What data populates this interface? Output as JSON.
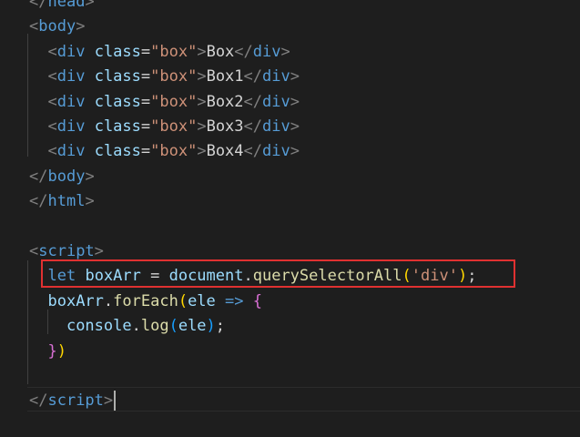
{
  "lines": [
    [
      [
        "punc",
        "</"
      ],
      [
        "tag",
        "head"
      ],
      [
        "punc",
        ">"
      ]
    ],
    [
      [
        "punc",
        "<"
      ],
      [
        "tag",
        "body"
      ],
      [
        "punc",
        ">"
      ]
    ],
    [
      [
        "pl",
        "  "
      ],
      [
        "punc",
        "<"
      ],
      [
        "tag",
        "div"
      ],
      [
        "pl",
        " "
      ],
      [
        "attr",
        "class"
      ],
      [
        "pl",
        "="
      ],
      [
        "str",
        "\"box\""
      ],
      [
        "punc",
        ">"
      ],
      [
        "txt",
        "Box"
      ],
      [
        "punc",
        "</"
      ],
      [
        "tag",
        "div"
      ],
      [
        "punc",
        ">"
      ]
    ],
    [
      [
        "pl",
        "  "
      ],
      [
        "punc",
        "<"
      ],
      [
        "tag",
        "div"
      ],
      [
        "pl",
        " "
      ],
      [
        "attr",
        "class"
      ],
      [
        "pl",
        "="
      ],
      [
        "str",
        "\"box\""
      ],
      [
        "punc",
        ">"
      ],
      [
        "txt",
        "Box1"
      ],
      [
        "punc",
        "</"
      ],
      [
        "tag",
        "div"
      ],
      [
        "punc",
        ">"
      ]
    ],
    [
      [
        "pl",
        "  "
      ],
      [
        "punc",
        "<"
      ],
      [
        "tag",
        "div"
      ],
      [
        "pl",
        " "
      ],
      [
        "attr",
        "class"
      ],
      [
        "pl",
        "="
      ],
      [
        "str",
        "\"box\""
      ],
      [
        "punc",
        ">"
      ],
      [
        "txt",
        "Box2"
      ],
      [
        "punc",
        "</"
      ],
      [
        "tag",
        "div"
      ],
      [
        "punc",
        ">"
      ]
    ],
    [
      [
        "pl",
        "  "
      ],
      [
        "punc",
        "<"
      ],
      [
        "tag",
        "div"
      ],
      [
        "pl",
        " "
      ],
      [
        "attr",
        "class"
      ],
      [
        "pl",
        "="
      ],
      [
        "str",
        "\"box\""
      ],
      [
        "punc",
        ">"
      ],
      [
        "txt",
        "Box3"
      ],
      [
        "punc",
        "</"
      ],
      [
        "tag",
        "div"
      ],
      [
        "punc",
        ">"
      ]
    ],
    [
      [
        "pl",
        "  "
      ],
      [
        "punc",
        "<"
      ],
      [
        "tag",
        "div"
      ],
      [
        "pl",
        " "
      ],
      [
        "attr",
        "class"
      ],
      [
        "pl",
        "="
      ],
      [
        "str",
        "\"box\""
      ],
      [
        "punc",
        ">"
      ],
      [
        "txt",
        "Box4"
      ],
      [
        "punc",
        "</"
      ],
      [
        "tag",
        "div"
      ],
      [
        "punc",
        ">"
      ]
    ],
    [
      [
        "punc",
        "</"
      ],
      [
        "tag",
        "body"
      ],
      [
        "punc",
        ">"
      ]
    ],
    [
      [
        "punc",
        "</"
      ],
      [
        "tag",
        "html"
      ],
      [
        "punc",
        ">"
      ]
    ],
    [],
    [
      [
        "punc",
        "<"
      ],
      [
        "tag",
        "script"
      ],
      [
        "punc",
        ">"
      ]
    ],
    [
      [
        "pl",
        "  "
      ],
      [
        "kw",
        "let"
      ],
      [
        "pl",
        " "
      ],
      [
        "var",
        "boxArr"
      ],
      [
        "pl",
        " = "
      ],
      [
        "var",
        "document"
      ],
      [
        "pl",
        "."
      ],
      [
        "fn",
        "querySelectorAll"
      ],
      [
        "p1",
        "("
      ],
      [
        "str",
        "'div'"
      ],
      [
        "p1",
        ")"
      ],
      [
        "pl",
        ";"
      ]
    ],
    [
      [
        "pl",
        "  "
      ],
      [
        "var",
        "boxArr"
      ],
      [
        "pl",
        "."
      ],
      [
        "fn",
        "forEach"
      ],
      [
        "p1",
        "("
      ],
      [
        "var",
        "ele"
      ],
      [
        "pl",
        " "
      ],
      [
        "kw",
        "=>"
      ],
      [
        "pl",
        " "
      ],
      [
        "p2",
        "{"
      ]
    ],
    [
      [
        "pl",
        "    "
      ],
      [
        "var",
        "console"
      ],
      [
        "pl",
        "."
      ],
      [
        "fn",
        "log"
      ],
      [
        "p3",
        "("
      ],
      [
        "var",
        "ele"
      ],
      [
        "p3",
        ")"
      ],
      [
        "pl",
        ";"
      ]
    ],
    [
      [
        "pl",
        "  "
      ],
      [
        "p2",
        "}"
      ],
      [
        "p1",
        ")"
      ]
    ],
    [],
    [
      [
        "punc",
        "</"
      ],
      [
        "tag",
        "script"
      ],
      [
        "punc",
        ">"
      ]
    ]
  ],
  "colors": {
    "background": "#1e1e1e",
    "highlight_border": "#e03131"
  }
}
